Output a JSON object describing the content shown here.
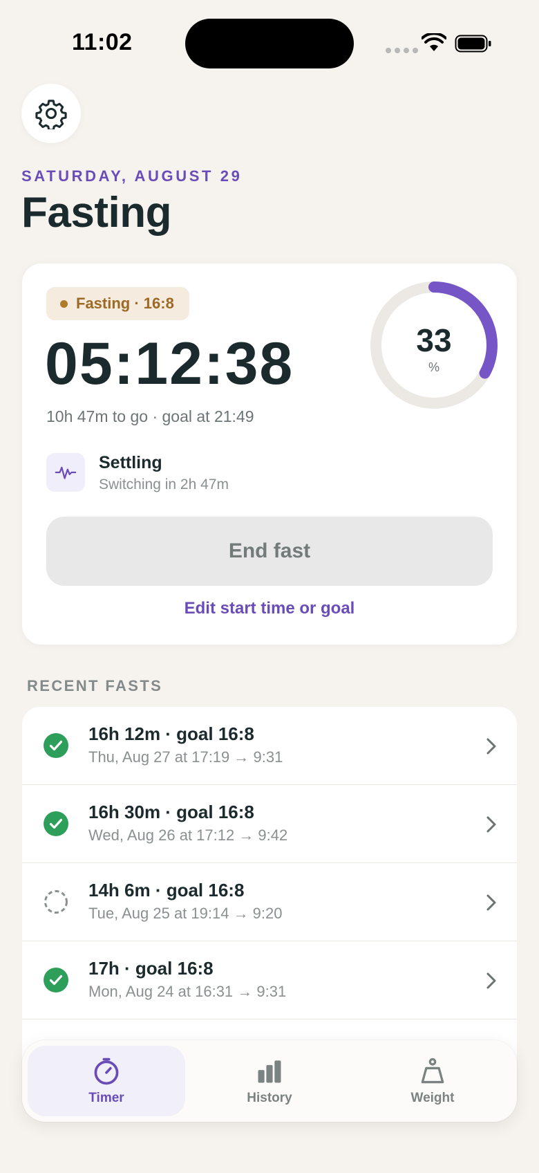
{
  "status_bar": {
    "time": "11:02"
  },
  "header": {
    "date": "SATURDAY, AUGUST 29",
    "title": "Fasting"
  },
  "current_fast": {
    "badge": "Fasting · 16:8",
    "elapsed": "05:12:38",
    "remaining": "10h 47m to go · goal at 21:49",
    "progress_percent": 33,
    "progress_value": "33",
    "progress_unit": "%",
    "phase_title": "Settling",
    "phase_subtitle": "Switching in 2h 47m",
    "end_button": "End fast",
    "edit_link": "Edit start time or goal"
  },
  "recent": {
    "label": "RECENT FASTS",
    "items": [
      {
        "title": "16h 12m · goal 16:8",
        "subtitle": "Thu, Aug 27 at 17:19 → 9:31",
        "status": "complete"
      },
      {
        "title": "16h 30m · goal 16:8",
        "subtitle": "Wed, Aug 26 at 17:12 → 9:42",
        "status": "complete"
      },
      {
        "title": "14h 6m · goal 16:8",
        "subtitle": "Tue, Aug 25 at 19:14 → 9:20",
        "status": "incomplete"
      },
      {
        "title": "17h · goal 16:8",
        "subtitle": "Mon, Aug 24 at 16:31 → 9:31",
        "status": "complete"
      }
    ]
  },
  "tabs": [
    {
      "label": "Timer",
      "icon": "timer-icon",
      "active": true
    },
    {
      "label": "History",
      "icon": "bar-chart-icon",
      "active": false
    },
    {
      "label": "Weight",
      "icon": "scale-icon",
      "active": false
    }
  ],
  "colors": {
    "accent": "#6a4cb8",
    "success": "#2e9e5b",
    "background": "#f6f3ee"
  }
}
